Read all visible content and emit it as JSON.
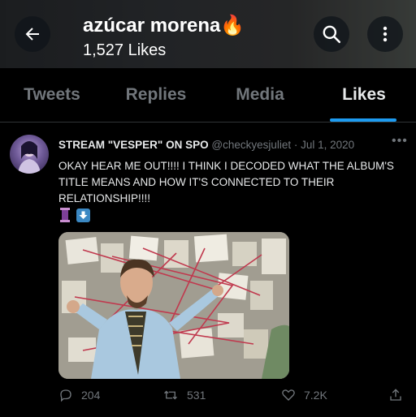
{
  "header": {
    "title": "azúcar morena🔥",
    "subtitle": "1,527 Likes"
  },
  "tabs": [
    {
      "label": "Tweets",
      "active": false
    },
    {
      "label": "Replies",
      "active": false
    },
    {
      "label": "Media",
      "active": false
    },
    {
      "label": "Likes",
      "active": true
    }
  ],
  "tweet": {
    "name": "STREAM \"VESPER\" ON SPO",
    "handle": "@checkyesjuliet",
    "date": "· Jul 1, 2020",
    "text": "OKAY HEAR ME OUT!!!! I THINK I DECODED WHAT THE ALBUM'S TITLE MEANS AND HOW IT'S CONNECTED TO THEIR RELATIONSHIP!!!!",
    "emojis": [
      "spool",
      "down-arrow"
    ],
    "replies": "204",
    "retweets": "531",
    "likes": "7.2K"
  },
  "colors": {
    "accent": "#1d9bf0",
    "muted": "#71767b",
    "text": "#e7e9ea",
    "background": "#000000"
  }
}
